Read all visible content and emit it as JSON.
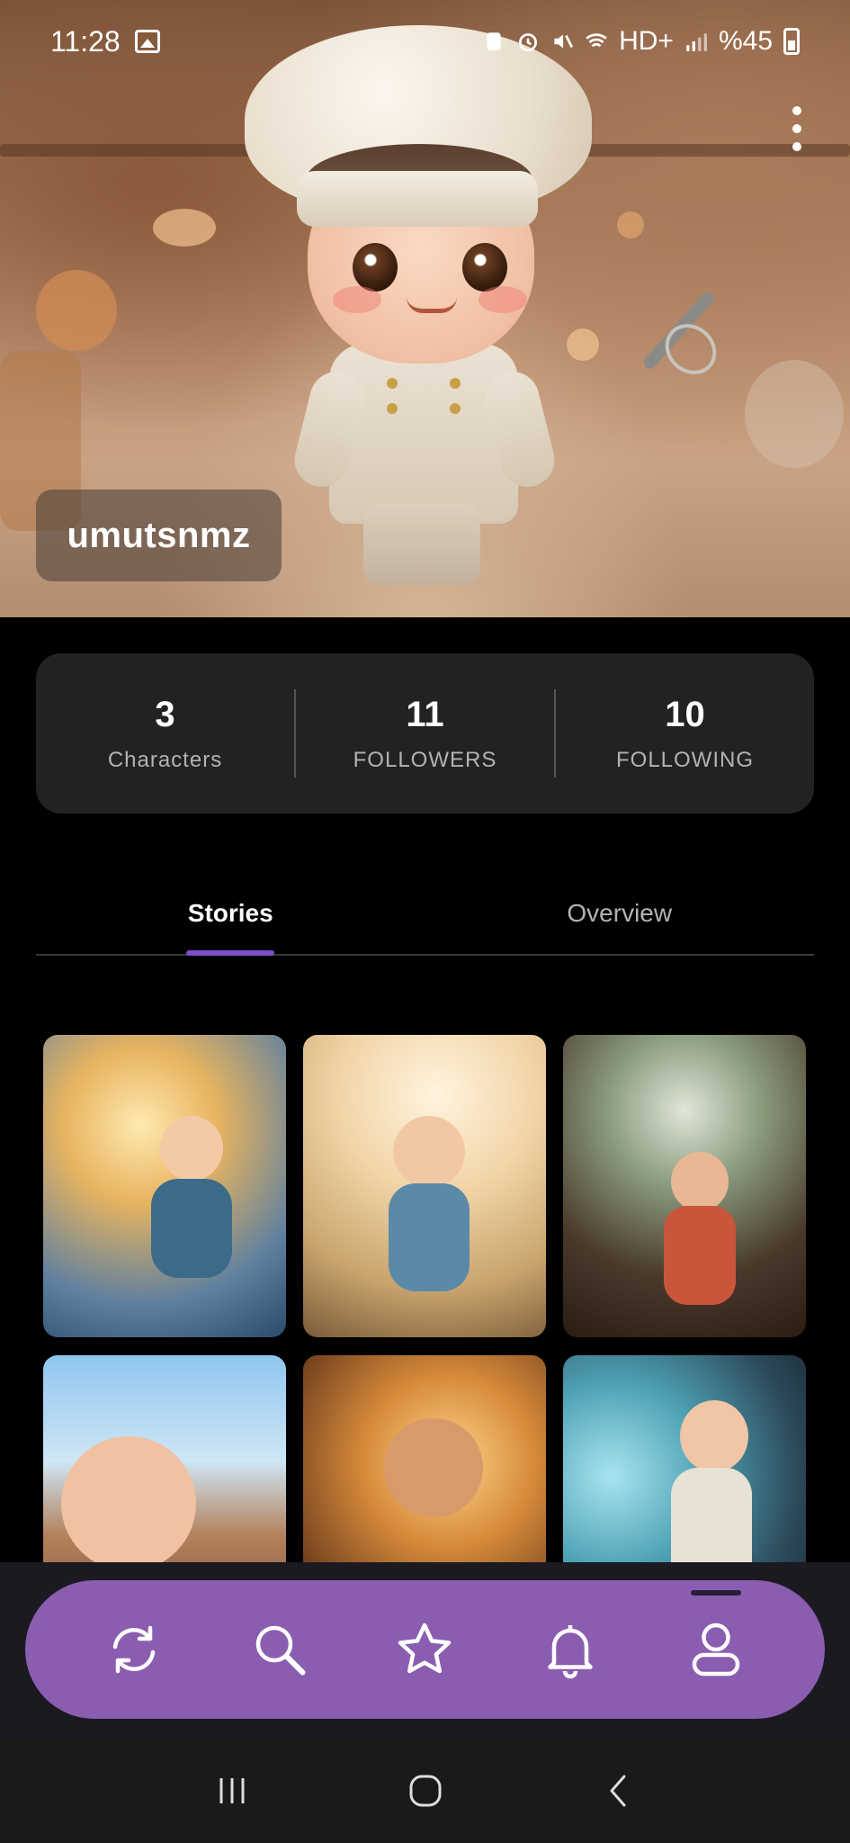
{
  "status_bar": {
    "time": "11:28",
    "network": "HD+",
    "battery": "%45"
  },
  "profile": {
    "username": "umutsnmz"
  },
  "stats": [
    {
      "value": "3",
      "label": "Characters"
    },
    {
      "value": "11",
      "label": "FOLLOWERS"
    },
    {
      "value": "10",
      "label": "FOLLOWING"
    }
  ],
  "tabs": {
    "stories": "Stories",
    "overview": "Overview",
    "active": "Stories"
  },
  "colors": {
    "accent": "#7e4fc7",
    "nav_bar": "#8b5db0",
    "card": "#222222"
  },
  "nav": {
    "items": [
      "refresh-icon",
      "search-icon",
      "star-icon",
      "bell-icon",
      "profile-icon"
    ],
    "active": "profile-icon"
  }
}
